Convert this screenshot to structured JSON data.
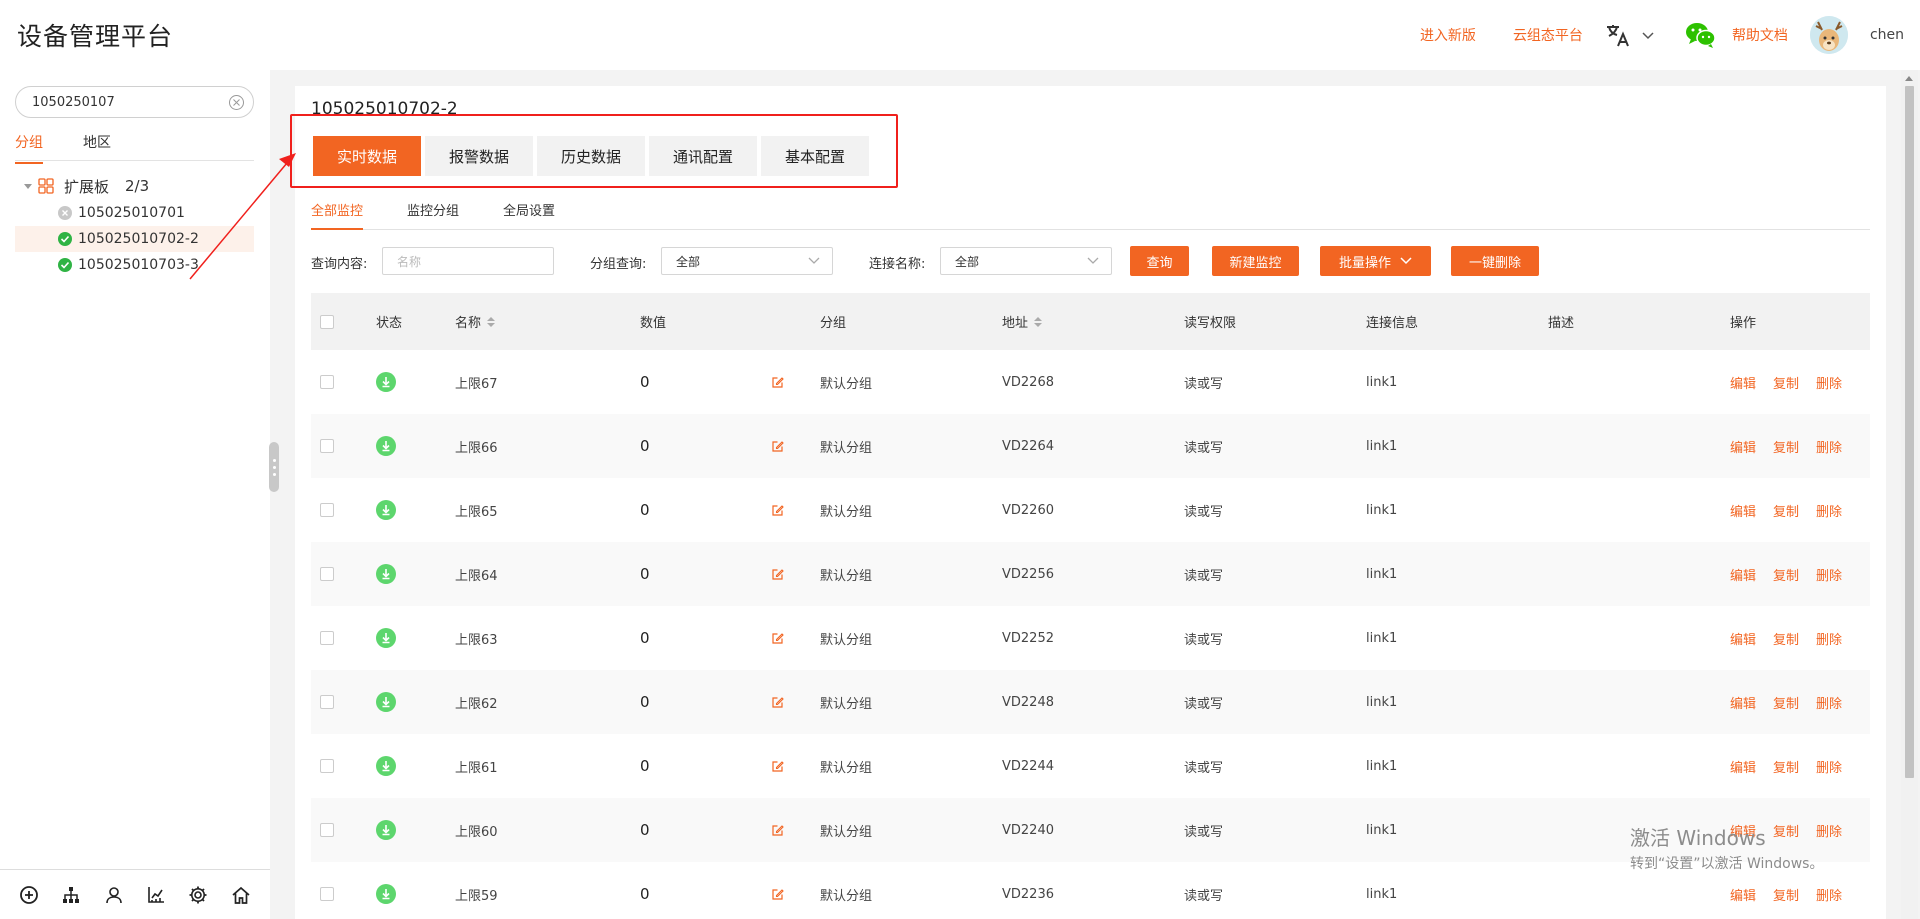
{
  "header": {
    "title": "设备管理平台",
    "new_version": "进入新版",
    "cloud_platform": "云组态平台",
    "help_docs": "帮助文档",
    "user_name": "chen",
    "icons": [
      "translate-icon",
      "chevron-down-icon",
      "wechat-icon",
      "avatar"
    ]
  },
  "sidebar": {
    "search_value": "1050250107",
    "tabs": [
      "分组",
      "地区"
    ],
    "tree_root": {
      "label": "扩展板",
      "count": "2/3"
    },
    "nodes": [
      {
        "label": "105025010701",
        "status": "offline"
      },
      {
        "label": "105025010702-2",
        "status": "online",
        "selected": true
      },
      {
        "label": "105025010703-3",
        "status": "online"
      }
    ],
    "bottom_icons": [
      "add-circle-icon",
      "org-tree-icon",
      "user-icon",
      "chart-icon",
      "settings-gear-icon",
      "home-icon"
    ]
  },
  "main": {
    "device_title": "105025010702-2",
    "tabs": [
      "实时数据",
      "报警数据",
      "历史数据",
      "通讯配置",
      "基本配置"
    ],
    "active_tab": "实时数据",
    "sub_tabs": [
      "全部监控",
      "监控分组",
      "全局设置"
    ],
    "filters": {
      "query_label": "查询内容:",
      "query_placeholder": "名称",
      "group_label": "分组查询:",
      "group_value": "全部",
      "conn_label": "连接名称:",
      "conn_value": "全部"
    },
    "buttons": {
      "query": "查询",
      "new_monitor": "新建监控",
      "batch": "批量操作",
      "delete_all": "一键删除"
    }
  },
  "table": {
    "columns": [
      "状态",
      "名称",
      "数值",
      "分组",
      "地址",
      "读写权限",
      "连接信息",
      "描述",
      "操作"
    ],
    "ops": [
      "编辑",
      "复制",
      "删除"
    ],
    "rows": [
      {
        "name": "上限67",
        "value": "0",
        "group": "默认分组",
        "address": "VD2268",
        "rw": "读或写",
        "conn": "link1",
        "desc": ""
      },
      {
        "name": "上限66",
        "value": "0",
        "group": "默认分组",
        "address": "VD2264",
        "rw": "读或写",
        "conn": "link1",
        "desc": ""
      },
      {
        "name": "上限65",
        "value": "0",
        "group": "默认分组",
        "address": "VD2260",
        "rw": "读或写",
        "conn": "link1",
        "desc": ""
      },
      {
        "name": "上限64",
        "value": "0",
        "group": "默认分组",
        "address": "VD2256",
        "rw": "读或写",
        "conn": "link1",
        "desc": ""
      },
      {
        "name": "上限63",
        "value": "0",
        "group": "默认分组",
        "address": "VD2252",
        "rw": "读或写",
        "conn": "link1",
        "desc": ""
      },
      {
        "name": "上限62",
        "value": "0",
        "group": "默认分组",
        "address": "VD2248",
        "rw": "读或写",
        "conn": "link1",
        "desc": ""
      },
      {
        "name": "上限61",
        "value": "0",
        "group": "默认分组",
        "address": "VD2244",
        "rw": "读或写",
        "conn": "link1",
        "desc": ""
      },
      {
        "name": "上限60",
        "value": "0",
        "group": "默认分组",
        "address": "VD2240",
        "rw": "读或写",
        "conn": "link1",
        "desc": ""
      },
      {
        "name": "上限59",
        "value": "0",
        "group": "默认分组",
        "address": "VD2236",
        "rw": "读或写",
        "conn": "link1",
        "desc": ""
      }
    ]
  },
  "watermark": {
    "line1": "激活 Windows",
    "line2": "转到“设置”以激活 Windows。"
  },
  "colors": {
    "accent": "#f26522",
    "online": "#2fb344",
    "offline": "#c8c8c8",
    "annotation": "#f0201c"
  }
}
